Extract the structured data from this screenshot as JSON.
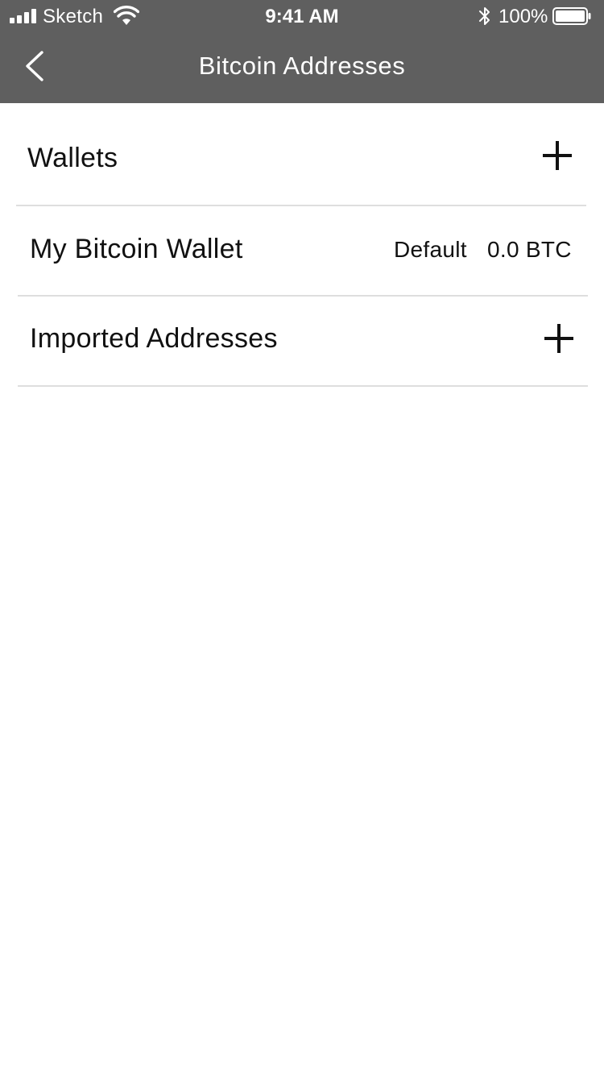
{
  "status_bar": {
    "carrier": "Sketch",
    "time": "9:41 AM",
    "battery_percent": "100%",
    "icons": [
      "signal-icon",
      "wifi-icon",
      "bluetooth-icon",
      "battery-icon"
    ]
  },
  "nav": {
    "title": "Bitcoin Addresses",
    "back_icon": "chevron-left-icon"
  },
  "sections": {
    "wallets": {
      "label": "Wallets",
      "action_icon": "plus-icon"
    },
    "wallet_row": {
      "name": "My Bitcoin Wallet",
      "default_label": "Default",
      "balance": "0.0 BTC"
    },
    "imported": {
      "label": "Imported Addresses",
      "action_icon": "plus-icon"
    }
  },
  "colors": {
    "header_bg": "#5f5f5f",
    "header_text": "#ffffff",
    "body_text": "#111111",
    "divider": "#dedede",
    "background": "#ffffff"
  }
}
